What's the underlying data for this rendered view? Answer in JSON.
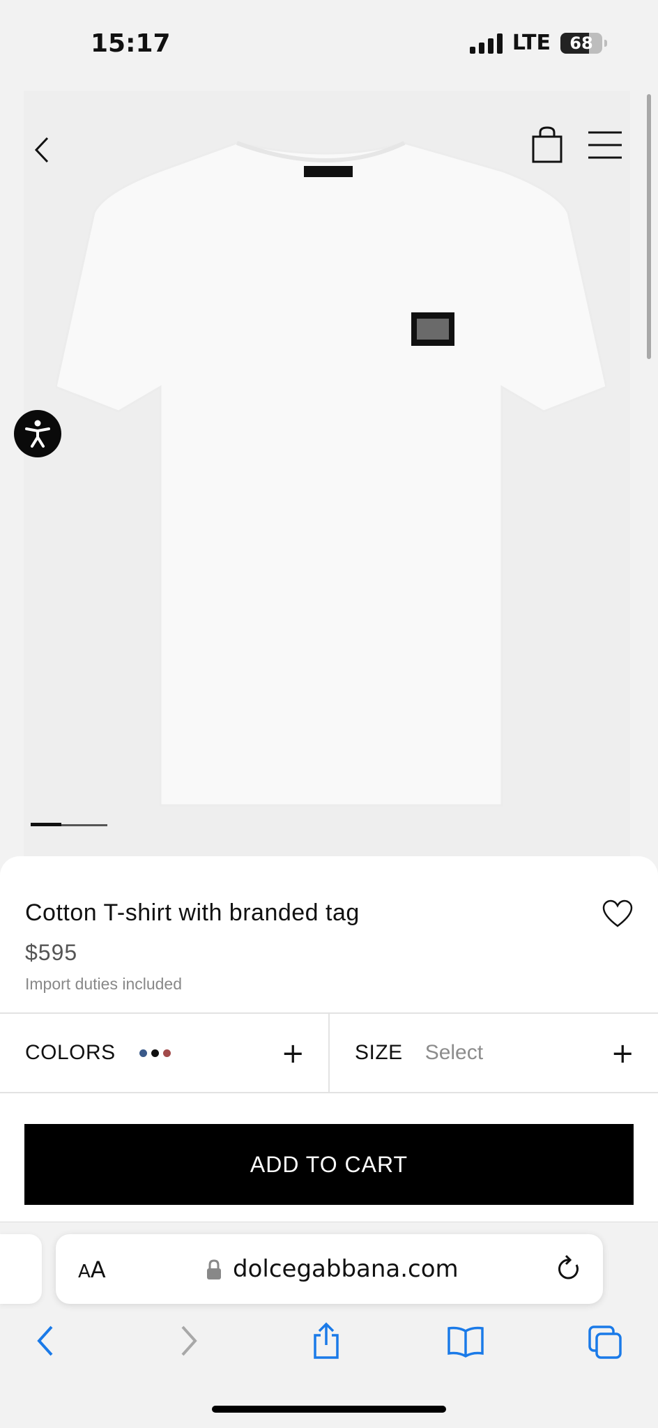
{
  "status_bar": {
    "time": "15:17",
    "network": "LTE",
    "battery": "68",
    "battery_level": 0.68
  },
  "icons": {
    "back": "chevron-left-icon",
    "bag": "shopping-bag-icon",
    "menu": "hamburger-menu-icon",
    "accessibility": "accessibility-icon",
    "wishlist": "heart-icon",
    "lock": "lock-icon",
    "reload": "reload-icon",
    "browser_back": "chevron-left-icon",
    "browser_forward": "chevron-right-icon",
    "share": "share-icon",
    "bookmarks": "book-icon",
    "tabs": "tabs-icon"
  },
  "gallery": {
    "image": "white cotton t-shirt with black branded neck label and metal chest plate",
    "current_index": 1
  },
  "product": {
    "title": "Cotton T-shirt with branded tag",
    "price": "$595",
    "duties_note": "Import duties included"
  },
  "options": {
    "colors_label": "COLORS",
    "color_swatches": [
      "#3a5a8a",
      "#111111",
      "#a24a4a"
    ],
    "size_label": "SIZE",
    "size_value": "Select",
    "expand_symbol": "+"
  },
  "cta": {
    "add_to_cart": "ADD TO CART"
  },
  "browser": {
    "text_size_small": "A",
    "text_size_large": "A",
    "url": "dolcegabbana.com"
  },
  "colors": {
    "accent": "#000000",
    "safari_blue": "#1a7ae8",
    "disabled_gray": "#a8a8a8"
  }
}
